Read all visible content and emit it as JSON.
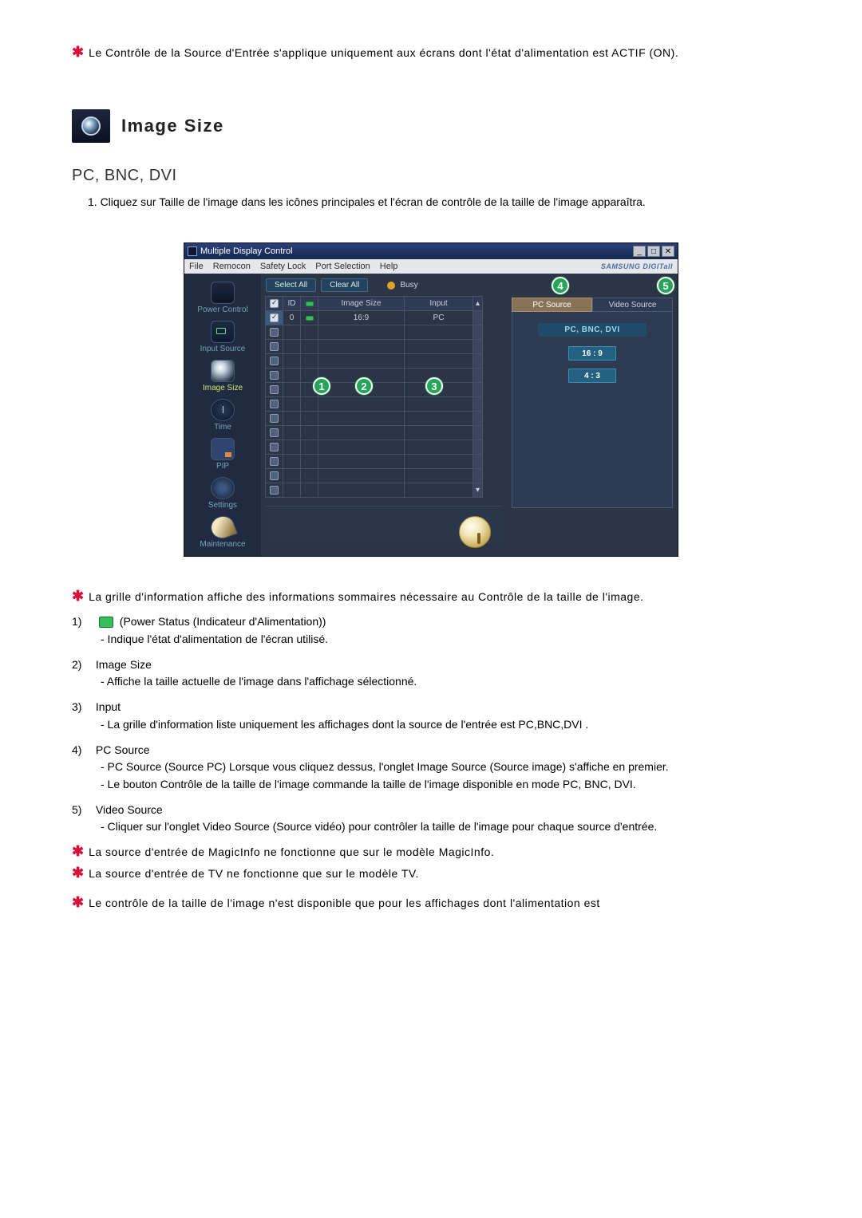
{
  "notes": {
    "top": "Le Contrôle de la Source d'Entrée s'applique uniquement aux écrans dont l'état d'alimentation est ACTIF (ON).",
    "grid": "La grille d'information affiche des informations sommaires nécessaire au Contrôle de la taille de l'image.",
    "magic": "La source d'entrée de MagicInfo ne fonctionne que sur le modèle MagicInfo.",
    "tv": "La source d'entrée de TV ne fonctionne que sur le modèle TV.",
    "bottom": "Le contrôle de la taille de l'image n'est disponible que pour les affichages dont l'alimentation est"
  },
  "section": {
    "title": "Image Size",
    "subtitle": "PC, BNC, DVI",
    "step1": "1. Cliquez sur Taille de l'image dans les icônes principales et l'écran de contrôle de la taille de l'image apparaîtra."
  },
  "win": {
    "title": "Multiple Display Control",
    "brand": "SAMSUNG DIGITall",
    "win_min": "_",
    "win_max": "□",
    "win_close": "✕",
    "menu": {
      "file": "File",
      "remocon": "Remocon",
      "safety": "Safety Lock",
      "port": "Port Selection",
      "help": "Help"
    },
    "sidebar": {
      "power": "Power Control",
      "input": "Input Source",
      "image": "Image Size",
      "time": "Time",
      "pip": "PIP",
      "settings": "Settings",
      "maint": "Maintenance"
    },
    "toolbar": {
      "select_all": "Select All",
      "clear_all": "Clear All",
      "busy": "Busy"
    },
    "headers": {
      "check": "✓",
      "id": "ID",
      "pwr": "",
      "size": "Image Size",
      "input": "Input"
    },
    "row1": {
      "id": "0",
      "size": "16:9",
      "input": "PC"
    },
    "right": {
      "pc_source": "PC Source",
      "video_source": "Video Source",
      "panel_title": "PC, BNC, DVI",
      "opt1": "16 : 9",
      "opt2": "4 : 3"
    }
  },
  "callouts": {
    "c1": "1",
    "c2": "2",
    "c3": "3",
    "c4": "4",
    "c5": "5"
  },
  "desc": {
    "d1": {
      "num": "1)",
      "title": "(Power Status (Indicateur d'Alimentation))",
      "line": "- Indique l'état d'alimentation de l'écran utilisé."
    },
    "d2": {
      "num": "2)",
      "title": "Image Size",
      "line": "- Affiche la taille actuelle de l'image dans l'affichage sélectionné."
    },
    "d3": {
      "num": "3)",
      "title": "Input",
      "line": "- La grille d'information liste uniquement les affichages dont la source de l'entrée est PC,BNC,DVI ."
    },
    "d4": {
      "num": "4)",
      "title": "PC Source",
      "line1": "- PC Source (Source PC) Lorsque vous cliquez dessus, l'onglet Image Source (Source image) s'affiche en premier.",
      "line2": "- Le bouton Contrôle de la taille de l'image commande la taille de l'image disponible en mode PC, BNC, DVI."
    },
    "d5": {
      "num": "5)",
      "title": "Video Source",
      "line": "- Cliquer sur l'onglet Video Source (Source vidéo) pour contrôler la taille de l'image pour chaque source d'entrée."
    }
  }
}
